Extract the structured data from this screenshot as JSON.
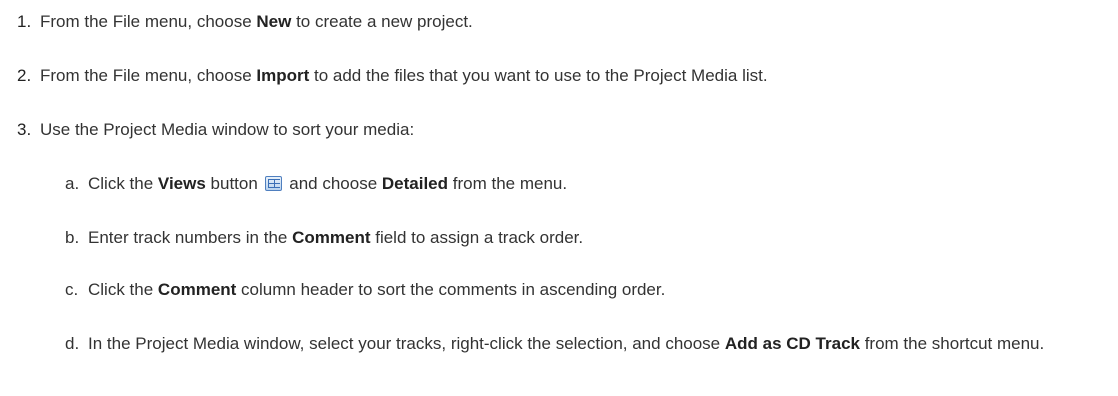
{
  "steps": [
    {
      "num": "1.",
      "pre": "From the File menu, choose ",
      "bold": "New",
      "post": " to create a new project."
    },
    {
      "num": "2.",
      "pre": "From the File menu, choose ",
      "bold": "Import",
      "post": " to add the files that you want to use to the Project Media list."
    },
    {
      "num": "3.",
      "text": "Use the Project Media window to sort your media:"
    }
  ],
  "substeps": {
    "a": {
      "num": "a.",
      "pre": "Click the ",
      "bold1": "Views",
      "mid": " button ",
      "icon": "views-icon",
      "mid2": " and choose ",
      "bold2": "Detailed",
      "post": " from the menu."
    },
    "b": {
      "num": "b.",
      "pre": "Enter track numbers in the ",
      "bold": "Comment",
      "post": " field to assign a track order."
    },
    "c": {
      "num": "c.",
      "pre": "Click the ",
      "bold": "Comment",
      "post": " column header to sort the comments in ascending order."
    },
    "d": {
      "num": "d.",
      "pre": "In the Project Media window, select your tracks, right-click the selection, and choose ",
      "bold": "Add as CD Track",
      "post": " from the shortcut menu."
    }
  }
}
